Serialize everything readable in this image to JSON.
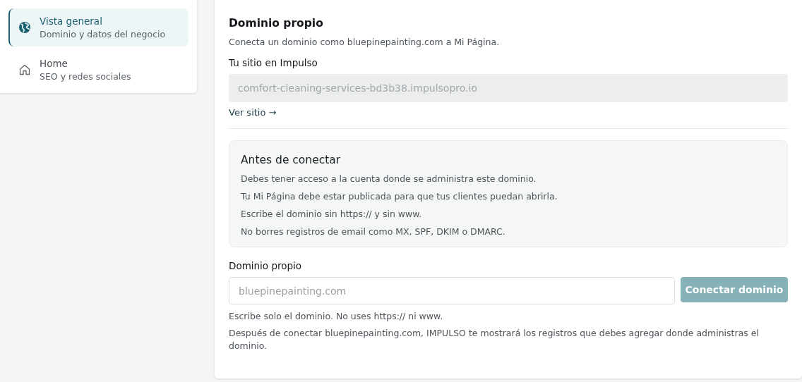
{
  "sidebar": {
    "items": [
      {
        "kind": "globe",
        "title": "Vista general",
        "subtitle": "Dominio y datos del negocio",
        "selected": true
      },
      {
        "kind": "home",
        "title": "Home",
        "subtitle": "SEO y redes sociales",
        "selected": false
      }
    ]
  },
  "panel": {
    "title": "Dominio propio",
    "description": "Conecta un dominio como bluepinepainting.com a Mi Página.",
    "site_label": "Tu sitio en Impulso",
    "site_value": "comfort-cleaning-services-bd3b38.impulsopro.io",
    "site_link": "Ver sitio →",
    "notice": {
      "title": "Antes de conectar",
      "lines": [
        "Debes tener acceso a la cuenta donde se administra este dominio.",
        "Tu Mi Página debe estar publicada para que tus clientes puedan abrirla.",
        "Escribe el dominio sin https:// y sin www.",
        "No borres registros de email como MX, SPF, DKIM o DMARC."
      ]
    },
    "domain_label": "Dominio propio",
    "domain_placeholder": "bluepinepainting.com",
    "connect_button": {
      "label": "Conectar dominio",
      "disabled": true
    },
    "hints": [
      "Escribe solo el dominio. No uses https:// ni www.",
      "Después de conectar bluepinepainting.com, IMPULSO te mostrará los registros que debes agregar donde administras el dominio."
    ]
  }
}
